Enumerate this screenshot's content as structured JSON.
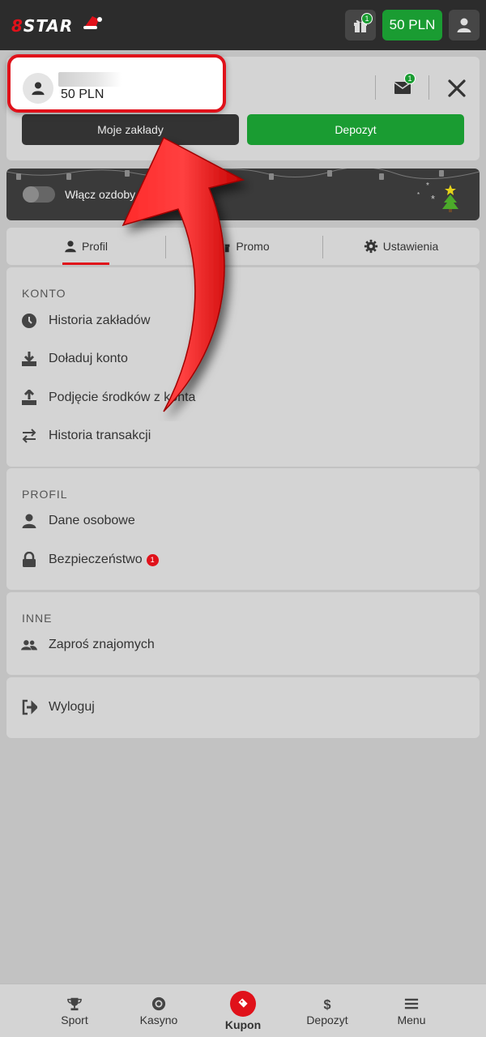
{
  "header": {
    "logo_prefix": "8",
    "logo_text": "STAR",
    "gift_badge": "1",
    "balance": "50 PLN"
  },
  "account": {
    "balance": "50 PLN",
    "mail_badge": "1",
    "my_bets_label": "Moje zakłady",
    "deposit_label": "Depozyt"
  },
  "decorations": {
    "toggle_label": "Włącz ozdoby",
    "enabled": false
  },
  "tabs": [
    {
      "label": "Profil",
      "active": true
    },
    {
      "label": "Promo",
      "active": false
    },
    {
      "label": "Ustawienia",
      "active": false
    }
  ],
  "sections": {
    "konto": {
      "title": "KONTO",
      "items": [
        {
          "label": "Historia zakładów",
          "icon": "clock-icon"
        },
        {
          "label": "Doładuj konto",
          "icon": "download-icon"
        },
        {
          "label": "Podjęcie środków z konta",
          "icon": "upload-icon"
        },
        {
          "label": "Historia transakcji",
          "icon": "transfer-icon"
        }
      ]
    },
    "profil": {
      "title": "PROFIL",
      "items": [
        {
          "label": "Dane osobowe",
          "icon": "user-icon"
        },
        {
          "label": "Bezpieczeństwo",
          "icon": "lock-icon",
          "badge": "1"
        }
      ]
    },
    "inne": {
      "title": "INNE",
      "items": [
        {
          "label": "Zaproś znajomych",
          "icon": "users-icon"
        }
      ]
    },
    "logout": {
      "label": "Wyloguj",
      "icon": "logout-icon"
    }
  },
  "bottom_nav": [
    {
      "label": "Sport",
      "icon": "trophy-icon"
    },
    {
      "label": "Kasyno",
      "icon": "chip-icon"
    },
    {
      "label": "Kupon",
      "icon": "ticket-icon"
    },
    {
      "label": "Depozyt",
      "icon": "dollar-icon"
    },
    {
      "label": "Menu",
      "icon": "hamburger-icon"
    }
  ],
  "colors": {
    "brand_red": "#e0111a",
    "brand_green": "#1a9c32",
    "topbar": "#2c2c2c",
    "background": "#c2c2c2"
  }
}
